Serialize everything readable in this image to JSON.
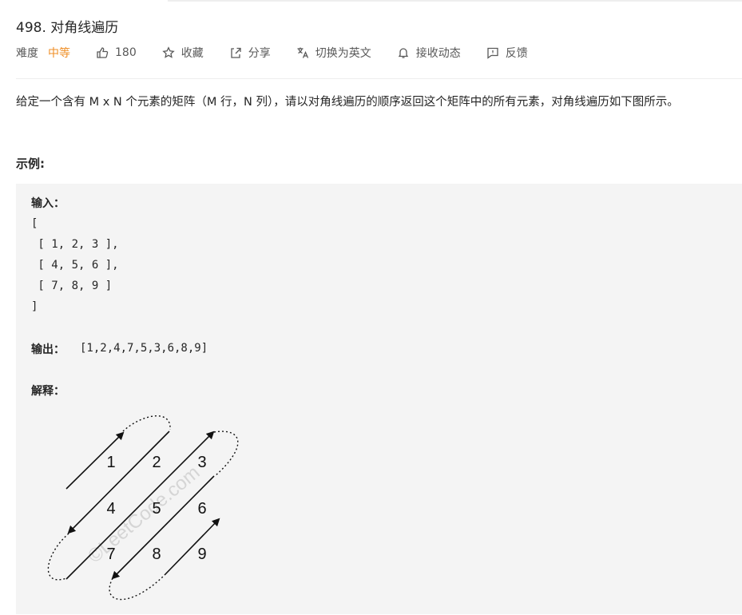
{
  "problem": {
    "title": "498. 对角线遍历",
    "difficulty_label": "难度",
    "difficulty_value": "中等",
    "likes": "180",
    "actions": {
      "favorite": "收藏",
      "share": "分享",
      "switch_lang": "切换为英文",
      "subscribe": "接收动态",
      "feedback": "反馈"
    },
    "description": "给定一个含有 M x N 个元素的矩阵（M 行，N 列），请以对角线遍历的顺序返回这个矩阵中的所有元素，对角线遍历如下图所示。"
  },
  "example": {
    "heading": "示例:",
    "input_label": "输入：",
    "input_lines": [
      "[",
      " [ 1, 2, 3 ],",
      " [ 4, 5, 6 ],",
      " [ 7, 8, 9 ]",
      "]"
    ],
    "output_label": "输出：",
    "output_value": "[1,2,4,7,5,3,6,8,9]",
    "explain_label": "解释："
  },
  "diagram": {
    "numbers": [
      "1",
      "2",
      "3",
      "4",
      "5",
      "6",
      "7",
      "8",
      "9"
    ],
    "watermark": "©LeetCode.com"
  },
  "colors": {
    "accent_orange": "#ef8f27",
    "code_bg": "#f4f4f4",
    "text": "#262626",
    "muted": "#595959"
  },
  "icons": [
    "thumbs-up-icon",
    "star-icon",
    "share-icon",
    "translate-icon",
    "bell-icon",
    "feedback-icon"
  ]
}
